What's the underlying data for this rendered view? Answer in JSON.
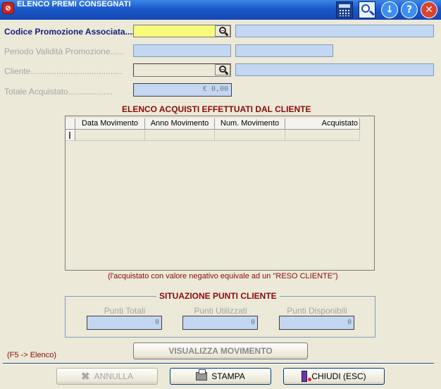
{
  "window": {
    "title": "ELENCO PREMI CONSEGNATI"
  },
  "toolbar": {
    "calculator_icon": "calculator-icon",
    "search_icon": "magnifier-icon",
    "down_glyph": "↓",
    "help_glyph": "?",
    "close_glyph": "✕"
  },
  "form": {
    "codice_label": "Codice Promozione Associata....",
    "periodo_label": "Periodo Validità Promozione......",
    "cliente_label": "Cliente.......................................",
    "totale_label": "Totale Acquistato...................",
    "totale_value": "€ 0,00"
  },
  "grid": {
    "title": "ELENCO ACQUISTI EFFETTUATI DAL CLIENTE",
    "columns": [
      "Data Movimento",
      "Anno Movimento",
      "Num. Movimento",
      "Acquistato"
    ],
    "rows": []
  },
  "note": "(l'acquistato con valore negativo equivale ad un \"RESO CLIENTE\")",
  "punti": {
    "title": "SITUAZIONE PUNTI CLIENTE",
    "totali_label": "Punti Totali",
    "utilizzati_label": "Punti Utilizzati",
    "disponibili_label": "Punti Disponibili",
    "totali_value": "0",
    "utilizzati_value": "0",
    "disponibili_value": "0"
  },
  "buttons": {
    "visualizza": "VISUALIZZA MOVIMENTO",
    "f5_hint": "(F5 -> Elenco)",
    "annulla": "ANNULLA",
    "stampa": "STAMPA",
    "chiudi": "CHIUDI (ESC)"
  },
  "colors": {
    "title_bar": "#1a59c9",
    "required_label": "#1a1a7a",
    "section_red": "#8b0b0b",
    "field_blue": "#c4d7f2",
    "field_yellow": "#fafa7a"
  }
}
